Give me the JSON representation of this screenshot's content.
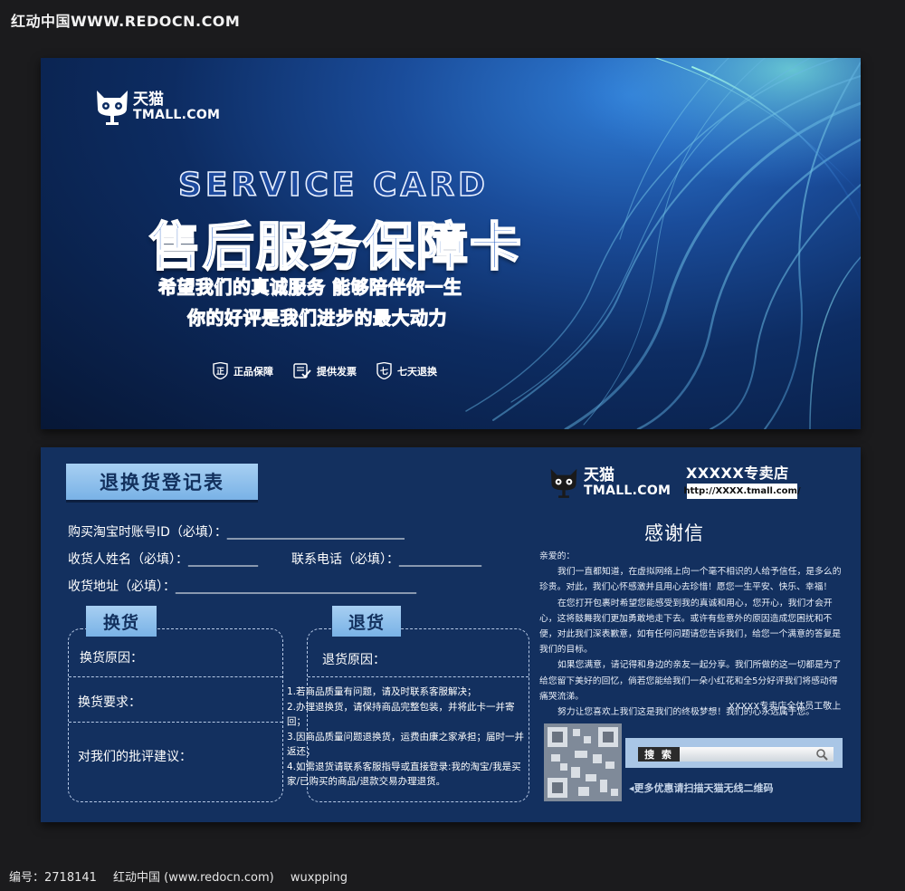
{
  "watermark_top": "红动中国WWW.REDOCN.COM",
  "footer": {
    "id_label": "编号：2718141",
    "site": "红动中国 (www.redocn.com)",
    "author": "wuxpping"
  },
  "front": {
    "logo_cn": "天猫",
    "logo_en": "TMALL.COM",
    "title_en": "SERVICE CARD",
    "title_cn": "售后服务保障卡",
    "slogan_1": "希望我们的真诚服务   能够陪伴你一生",
    "slogan_2": "你的好评是我们进步的最大动力",
    "badges": [
      {
        "icon": "shield-zheng-icon",
        "glyph": "正",
        "label": "正品保障"
      },
      {
        "icon": "invoice-check-icon",
        "glyph": "",
        "label": "提供发票"
      },
      {
        "icon": "shield-seven-icon",
        "glyph": "七",
        "label": "七天退换"
      }
    ]
  },
  "back": {
    "register_title": "退换货登记表",
    "fields": {
      "account": "购买淘宝时账号ID（必填）：____________________________",
      "name": "收货人姓名（必填）：___________",
      "phone": "联系电话（必填）：_____________",
      "address": "收货地址（必填）：______________________________________"
    },
    "exchange": {
      "tab": "换货",
      "reason": "换货原因：",
      "request": "换货要求：",
      "feedback": "对我们的批评建议："
    },
    "return": {
      "tab": "退货",
      "reason": "退货原因：",
      "rules": [
        "1.若商品质量有问题，请及时联系客服解决；",
        "2.办理退换货，请保持商品完整包装，并将此卡一并寄回；",
        "3.因商品质量问题退换货，运费由康之家承担；届时一并返还；",
        "4.如需退货请联系客服指导或直接登录:我的淘宝/我是买家/已购买的商品/退款交易办理退货。"
      ]
    },
    "logo_cn": "天猫",
    "logo_en": "TMALL.COM",
    "store_name": "XXXXX专卖店",
    "store_url": "http://XXXX.tmall.com/",
    "thanks_title": "感谢信",
    "letter": {
      "greeting": "亲爱的：",
      "p1": "我们一直都知道，在虚拟网络上向一个毫不相识的人给予信任，是多么的珍贵。对此，我们心怀感激并且用心去珍惜！愿您一生平安、快乐、幸福！",
      "p2": "在您打开包裹时希望您能感受到我的真诚和用心，您开心，我们才会开心，这将鼓舞我们更加勇敢地走下去。或许有些意外的原因造成您困扰和不便，对此我们深表歉意，如有任何问题请您告诉我们，给您一个满意的答复是我们的目标。",
      "p3": "如果您满意，请记得和身边的亲友一起分享。我们所做的这一切都是为了给您留下美好的回忆，倘若您能给我们一朵小红花和全5分好评我们将感动得痛哭流涕。",
      "p4": "努力让您喜欢上我们这是我们的终极梦想！我们的心永远属于您。",
      "signature": "XXXXX专卖店全体员工敬上"
    },
    "search_label": "搜 索",
    "promo": "更多优惠请扫描天猫无线二维码"
  }
}
